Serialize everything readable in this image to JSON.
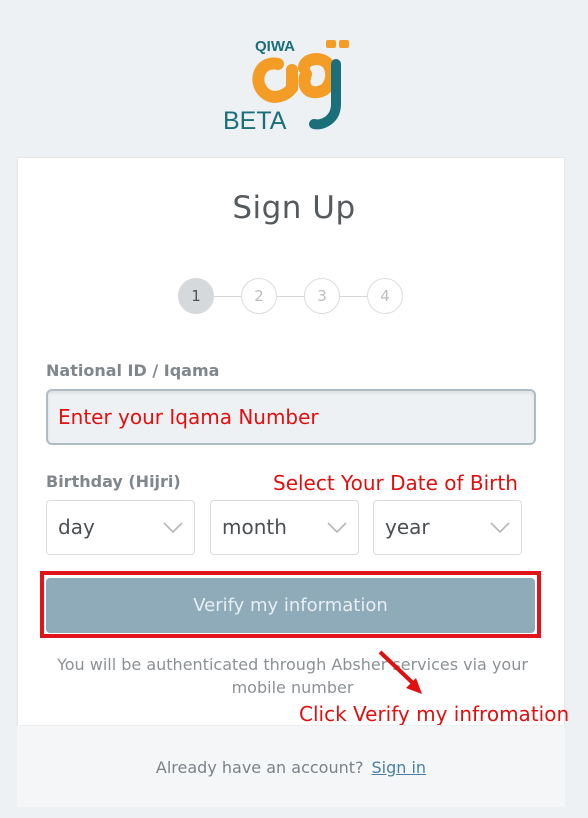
{
  "logo": {
    "brand_text": "QIWA",
    "badge_text": "BETA",
    "brand_color": "#f39c26",
    "accent_color": "#1b6f7a"
  },
  "title": "Sign Up",
  "stepper": {
    "steps": [
      "1",
      "2",
      "3",
      "4"
    ],
    "active_step": 1
  },
  "national_id": {
    "label": "National ID / Iqama",
    "value": ""
  },
  "birthday": {
    "label": "Birthday (Hijri)",
    "day": "day",
    "month": "month",
    "year": "year"
  },
  "verify_button": "Verify my information",
  "auth_text": "You will be authenticated through Absher services via your mobile number",
  "footer": {
    "prompt": "Already have an account?",
    "signin": "Sign in"
  },
  "annotations": {
    "iqama": "Enter your Iqama Number",
    "dob": "Select Your Date of Birth",
    "verify": "Click Verify my infromation"
  },
  "colors": {
    "button": "#8faab9",
    "annotation": "#e01010",
    "link": "#4a7fa5"
  }
}
